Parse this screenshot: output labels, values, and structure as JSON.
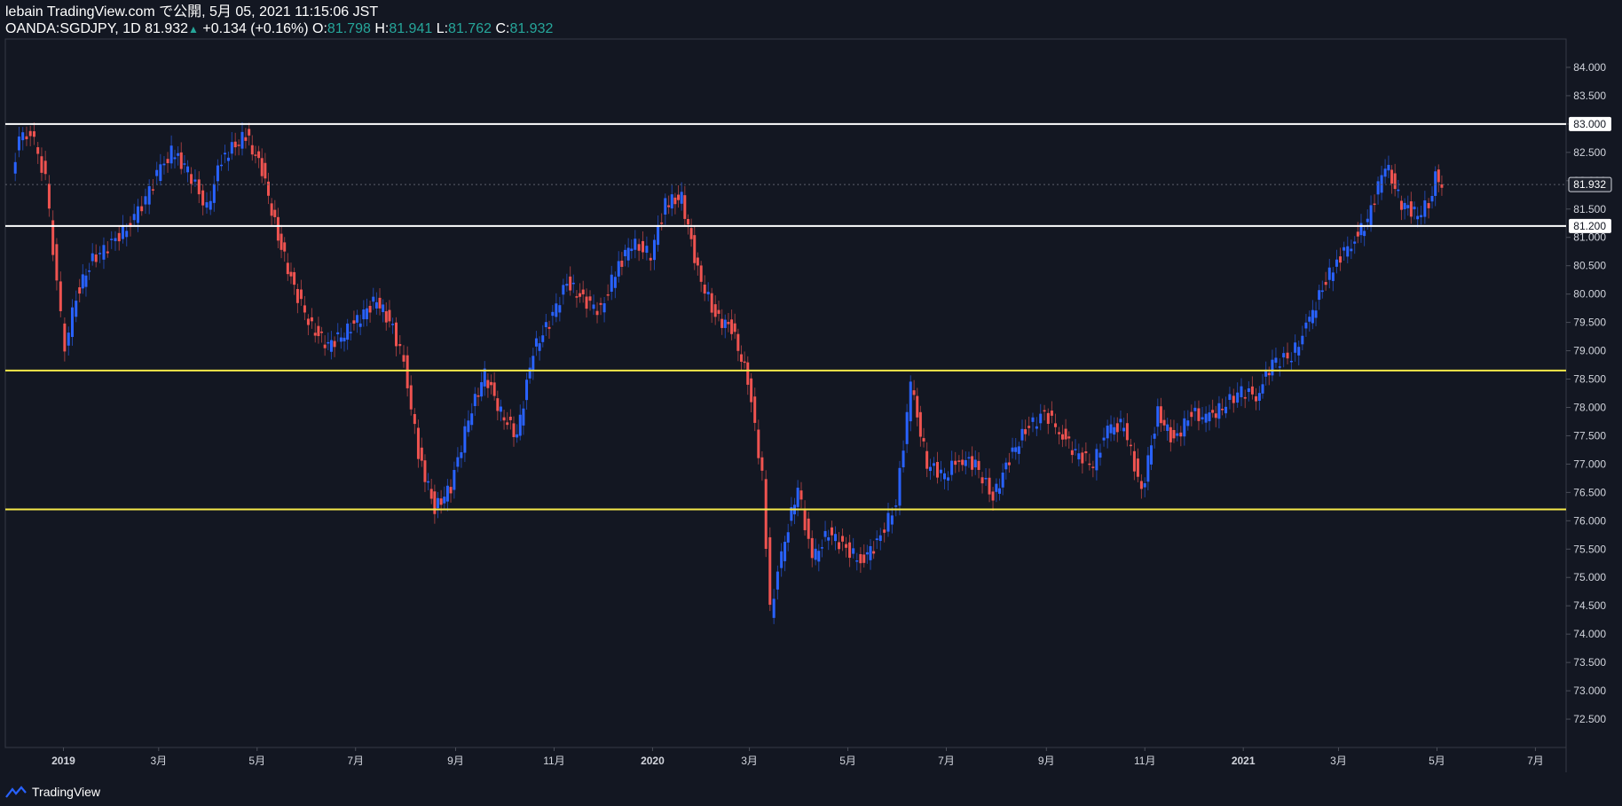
{
  "header": {
    "line1": "lebain TradingView.com で公開, 5月 05, 2021 11:15:06 JST",
    "symbol": "OANDA:SGDJPY, 1D",
    "last": "81.932",
    "up_glyph": "▲",
    "change": "+0.134 (+0.16%)",
    "o_label": "O:",
    "o_value": "81.798",
    "h_label": "H:",
    "h_value": "81.941",
    "l_label": "L:",
    "l_value": "81.762",
    "c_label": "C:",
    "c_value": "81.932"
  },
  "footer": {
    "brand": "TradingView"
  },
  "colors": {
    "background": "#131722",
    "up": "#2962ff",
    "down": "#ef5350",
    "white_level": "#ffffff",
    "yellow_level": "#f5e94a",
    "axis_text": "#d1d4dc"
  },
  "chart_data": {
    "type": "line",
    "symbol": "OANDA:SGDJPY",
    "interval": "1D",
    "ylim": [
      72.0,
      84.5
    ],
    "y_ticks": [
      "84.000",
      "83.500",
      "83.000",
      "82.500",
      "82.000",
      "81.500",
      "81.000",
      "80.500",
      "80.000",
      "79.500",
      "79.000",
      "78.500",
      "78.000",
      "77.500",
      "77.000",
      "76.500",
      "76.000",
      "75.500",
      "75.000",
      "74.500",
      "74.000",
      "73.500",
      "73.000",
      "72.500"
    ],
    "x_ticks": [
      "2019",
      "3月",
      "5月",
      "7月",
      "9月",
      "11月",
      "2020",
      "3月",
      "5月",
      "7月",
      "9月",
      "11月",
      "2021",
      "3月",
      "5月",
      "7月"
    ],
    "levels": [
      {
        "value": 83.0,
        "label": "83.000",
        "color": "#ffffff"
      },
      {
        "value": 81.2,
        "label": "81.200",
        "color": "#ffffff"
      },
      {
        "value": 78.65,
        "label": "",
        "color": "#f5e94a"
      },
      {
        "value": 76.2,
        "label": "",
        "color": "#f5e94a"
      }
    ],
    "last_price": {
      "value": 81.932,
      "label": "81.932"
    },
    "price_path": [
      [
        "2018-12-01",
        82.2
      ],
      [
        "2018-12-08",
        82.9
      ],
      [
        "2018-12-15",
        82.7
      ],
      [
        "2018-12-22",
        82.0
      ],
      [
        "2018-12-29",
        80.2
      ],
      [
        "2019-01-03",
        79.0
      ],
      [
        "2019-01-10",
        80.0
      ],
      [
        "2019-01-20",
        80.6
      ],
      [
        "2019-02-01",
        80.9
      ],
      [
        "2019-02-15",
        81.3
      ],
      [
        "2019-03-01",
        82.1
      ],
      [
        "2019-03-10",
        82.5
      ],
      [
        "2019-03-20",
        82.2
      ],
      [
        "2019-04-01",
        81.5
      ],
      [
        "2019-04-10",
        82.4
      ],
      [
        "2019-04-25",
        82.8
      ],
      [
        "2019-05-05",
        82.2
      ],
      [
        "2019-05-15",
        81.0
      ],
      [
        "2019-05-25",
        80.1
      ],
      [
        "2019-06-05",
        79.4
      ],
      [
        "2019-06-15",
        79.1
      ],
      [
        "2019-06-25",
        79.3
      ],
      [
        "2019-07-05",
        79.6
      ],
      [
        "2019-07-15",
        79.9
      ],
      [
        "2019-07-25",
        79.4
      ],
      [
        "2019-08-01",
        78.8
      ],
      [
        "2019-08-10",
        77.2
      ],
      [
        "2019-08-20",
        76.2
      ],
      [
        "2019-08-30",
        76.6
      ],
      [
        "2019-09-10",
        77.8
      ],
      [
        "2019-09-20",
        78.6
      ],
      [
        "2019-09-30",
        77.9
      ],
      [
        "2019-10-10",
        77.5
      ],
      [
        "2019-10-20",
        79.0
      ],
      [
        "2019-10-30",
        79.5
      ],
      [
        "2019-11-10",
        80.2
      ],
      [
        "2019-11-20",
        79.9
      ],
      [
        "2019-12-01",
        79.7
      ],
      [
        "2019-12-10",
        80.4
      ],
      [
        "2019-12-20",
        80.9
      ],
      [
        "2020-01-01",
        80.7
      ],
      [
        "2020-01-10",
        81.6
      ],
      [
        "2020-01-20",
        81.7
      ],
      [
        "2020-01-30",
        80.4
      ],
      [
        "2020-02-10",
        79.6
      ],
      [
        "2020-02-20",
        79.4
      ],
      [
        "2020-03-01",
        78.5
      ],
      [
        "2020-03-10",
        76.8
      ],
      [
        "2020-03-15",
        74.4
      ],
      [
        "2020-03-22",
        75.4
      ],
      [
        "2020-04-01",
        76.6
      ],
      [
        "2020-04-10",
        75.3
      ],
      [
        "2020-04-20",
        75.8
      ],
      [
        "2020-05-01",
        75.5
      ],
      [
        "2020-05-10",
        75.3
      ],
      [
        "2020-05-20",
        75.6
      ],
      [
        "2020-06-01",
        76.3
      ],
      [
        "2020-06-10",
        78.4
      ],
      [
        "2020-06-20",
        77.0
      ],
      [
        "2020-07-01",
        76.8
      ],
      [
        "2020-07-10",
        77.1
      ],
      [
        "2020-07-20",
        77.0
      ],
      [
        "2020-07-31",
        76.4
      ],
      [
        "2020-08-10",
        77.1
      ],
      [
        "2020-08-20",
        77.6
      ],
      [
        "2020-09-01",
        77.9
      ],
      [
        "2020-09-10",
        77.6
      ],
      [
        "2020-09-20",
        77.2
      ],
      [
        "2020-10-01",
        77.0
      ],
      [
        "2020-10-10",
        77.6
      ],
      [
        "2020-10-20",
        77.7
      ],
      [
        "2020-10-31",
        76.5
      ],
      [
        "2020-11-10",
        77.9
      ],
      [
        "2020-11-20",
        77.4
      ],
      [
        "2020-12-01",
        77.9
      ],
      [
        "2020-12-10",
        77.8
      ],
      [
        "2020-12-20",
        78.0
      ],
      [
        "2021-01-01",
        78.3
      ],
      [
        "2021-01-10",
        78.2
      ],
      [
        "2021-01-20",
        78.8
      ],
      [
        "2021-02-01",
        78.9
      ],
      [
        "2021-02-10",
        79.4
      ],
      [
        "2021-02-20",
        80.1
      ],
      [
        "2021-03-01",
        80.6
      ],
      [
        "2021-03-10",
        80.9
      ],
      [
        "2021-03-20",
        81.3
      ],
      [
        "2021-03-31",
        82.3
      ],
      [
        "2021-04-10",
        81.6
      ],
      [
        "2021-04-20",
        81.4
      ],
      [
        "2021-04-27",
        81.6
      ],
      [
        "2021-05-01",
        82.1
      ],
      [
        "2021-05-05",
        81.932
      ]
    ]
  }
}
